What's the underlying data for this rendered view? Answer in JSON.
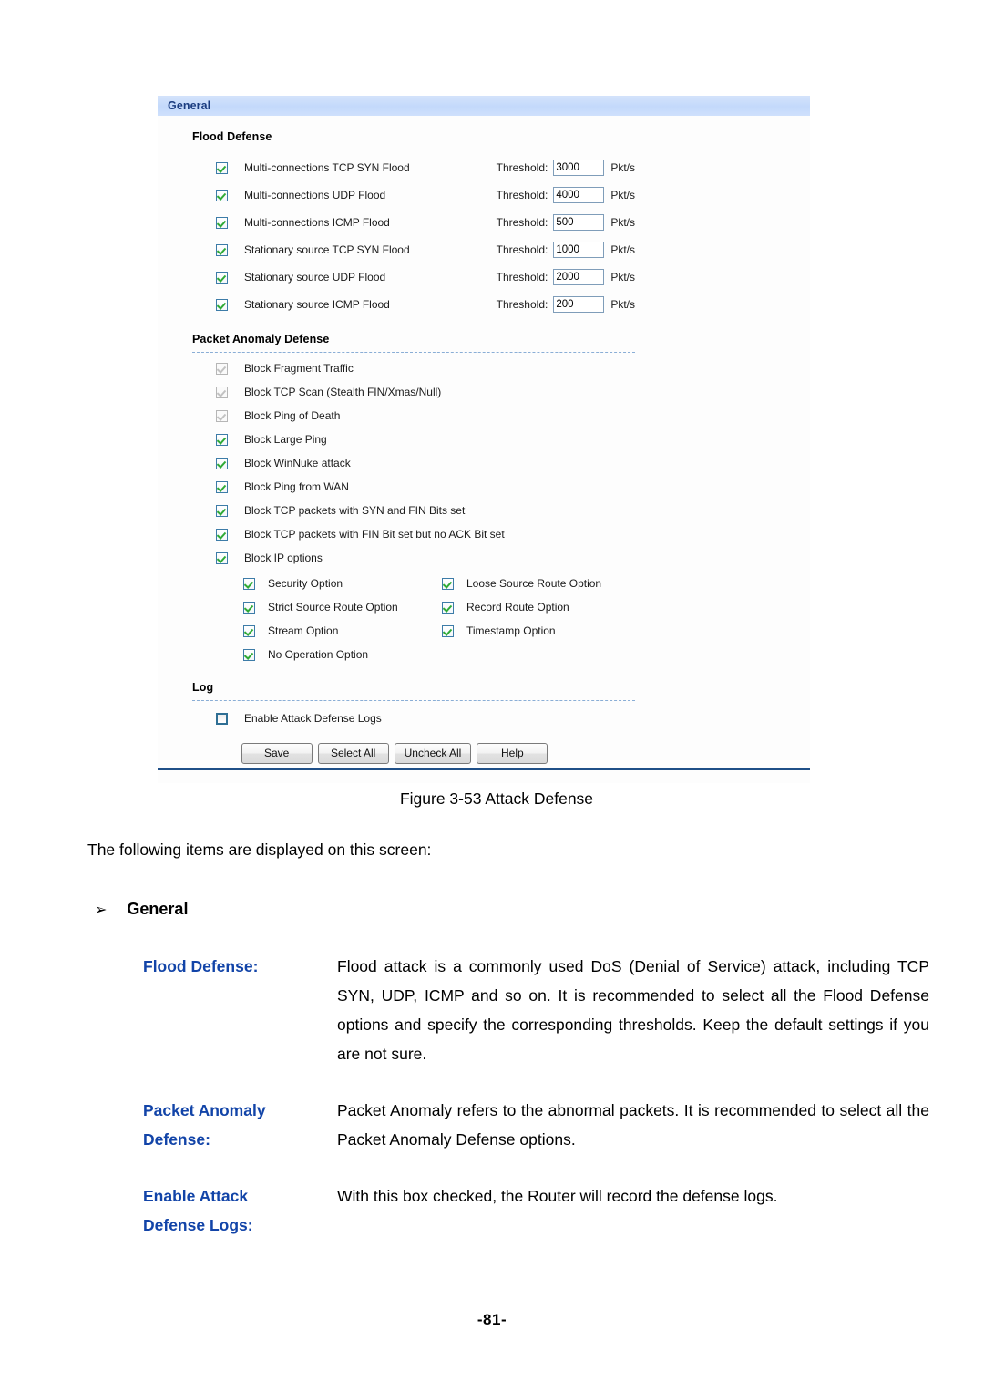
{
  "figure": {
    "panel_title": "General",
    "flood_defense": {
      "section_label": "Flood Defense",
      "threshold_label": "Threshold:",
      "unit_label": "Pkt/s",
      "items": [
        {
          "label": "Multi-connections TCP SYN Flood",
          "checked": true,
          "threshold": "3000"
        },
        {
          "label": "Multi-connections UDP Flood",
          "checked": true,
          "threshold": "4000"
        },
        {
          "label": "Multi-connections ICMP Flood",
          "checked": true,
          "threshold": "500"
        },
        {
          "label": "Stationary source TCP SYN Flood",
          "checked": true,
          "threshold": "1000"
        },
        {
          "label": "Stationary source UDP Flood",
          "checked": true,
          "threshold": "2000"
        },
        {
          "label": "Stationary source ICMP Flood",
          "checked": true,
          "threshold": "200"
        }
      ]
    },
    "packet_anomaly": {
      "section_label": "Packet Anomaly Defense",
      "items": [
        {
          "label": "Block Fragment Traffic",
          "checked": true,
          "disabled": true
        },
        {
          "label": "Block TCP Scan (Stealth FIN/Xmas/Null)",
          "checked": true,
          "disabled": true
        },
        {
          "label": "Block Ping of Death",
          "checked": true,
          "disabled": true
        },
        {
          "label": "Block Large Ping",
          "checked": true,
          "disabled": false
        },
        {
          "label": "Block WinNuke attack",
          "checked": true,
          "disabled": false
        },
        {
          "label": "Block Ping from WAN",
          "checked": true,
          "disabled": false
        },
        {
          "label": "Block TCP packets with SYN and FIN Bits set",
          "checked": true,
          "disabled": false
        },
        {
          "label": "Block TCP packets with FIN Bit set but no ACK Bit set",
          "checked": true,
          "disabled": false
        },
        {
          "label": "Block IP options",
          "checked": true,
          "disabled": false
        }
      ],
      "ip_option_rows": [
        [
          {
            "label": "Security Option",
            "checked": true
          },
          {
            "label": "Loose Source Route Option",
            "checked": true
          }
        ],
        [
          {
            "label": "Strict Source Route Option",
            "checked": true
          },
          {
            "label": "Record Route Option",
            "checked": true
          }
        ],
        [
          {
            "label": "Stream Option",
            "checked": true
          },
          {
            "label": "Timestamp Option",
            "checked": true
          }
        ],
        [
          {
            "label": "No Operation Option",
            "checked": true
          }
        ]
      ]
    },
    "log": {
      "section_label": "Log",
      "enable_label": "Enable Attack Defense Logs",
      "enable_checked": false
    },
    "buttons": [
      {
        "label": "Save"
      },
      {
        "label": "Select All"
      },
      {
        "label": "Uncheck All"
      },
      {
        "label": "Help"
      }
    ],
    "colors": {
      "header_bar": "#c3d9fb",
      "header_text": "#1b3d80",
      "check_green": "#2faa36",
      "checkbox_border": "#3d7ca8",
      "bottom_rule": "#1f4f87",
      "dashed_rule": "#8aaed6"
    }
  },
  "document": {
    "figure_caption": "Figure 3-53 Attack Defense",
    "intro": "The following items are displayed on this screen:",
    "bullet_arrow": "➢",
    "bullet_heading": "General",
    "definitions": [
      {
        "term": "Flood Defense:",
        "term_line2": "",
        "description": "Flood attack is a commonly used DoS (Denial of Service) attack, including TCP SYN, UDP, ICMP and so on. It is recommended to select all the Flood Defense options and specify the corresponding thresholds. Keep the default settings if you are not sure."
      },
      {
        "term": "Packet Anomaly",
        "term_line2": "Defense:",
        "description": "Packet Anomaly refers to the abnormal packets. It is recommended to select all the Packet Anomaly Defense options."
      },
      {
        "term": "Enable Attack",
        "term_line2": "Defense Logs:",
        "description": "With this box checked, the Router will record the defense logs."
      }
    ],
    "page_number": "-81-",
    "colors": {
      "term_blue": "#1244a8"
    }
  }
}
